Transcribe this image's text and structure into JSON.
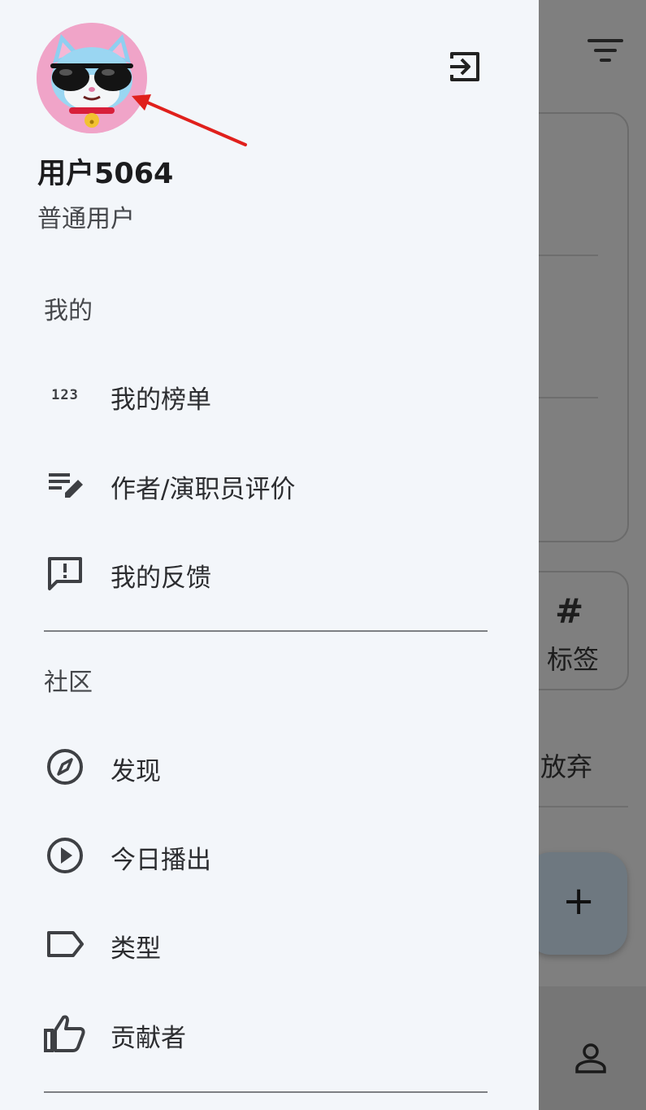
{
  "background": {
    "tag_hash": "#",
    "tag_label": "标签",
    "give_up_label": "放弃",
    "fab_label": "+",
    "icons": {
      "filter": "filter-icon",
      "add": "plus-icon",
      "profile": "person-icon"
    }
  },
  "drawer": {
    "user": {
      "name": "用户5064",
      "role": "普通用户",
      "avatar": "cat-avatar-with-sunglasses"
    },
    "logout_icon": "logout-icon",
    "sections": [
      {
        "title": "我的",
        "items": [
          {
            "label": "我的榜单",
            "icon": "numbers-123-icon",
            "icon_text": "123"
          },
          {
            "label": "作者/演职员评价",
            "icon": "rate-review-icon"
          },
          {
            "label": "我的反馈",
            "icon": "feedback-icon"
          }
        ]
      },
      {
        "title": "社区",
        "items": [
          {
            "label": "发现",
            "icon": "compass-icon"
          },
          {
            "label": "今日播出",
            "icon": "play-circle-icon"
          },
          {
            "label": "类型",
            "icon": "label-tag-icon"
          },
          {
            "label": "贡献者",
            "icon": "thumb-up-icon"
          }
        ]
      }
    ]
  },
  "colors": {
    "drawer_bg": "#f3f6fa",
    "scrim": "#7f7f7f",
    "arrow": "#e0201c",
    "avatar_bg": "#f0a4c8"
  }
}
